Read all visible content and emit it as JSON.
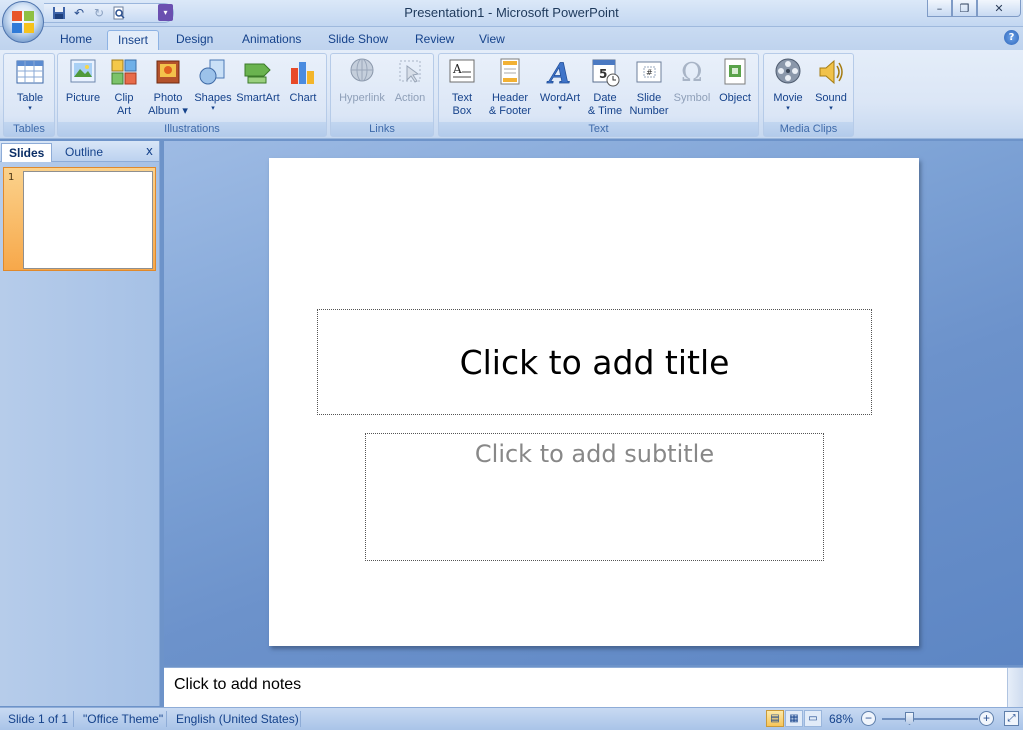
{
  "window": {
    "title": "Presentation1 - Microsoft PowerPoint",
    "controls": {
      "minimize": "–",
      "restore": "❐",
      "close": "✕"
    }
  },
  "qat": {
    "save_icon": "save-icon",
    "undo_icon": "undo-icon",
    "redo_icon": "redo-icon",
    "preview_icon": "print-preview-icon"
  },
  "tabs": [
    "Home",
    "Insert",
    "Design",
    "Animations",
    "Slide Show",
    "Review",
    "View"
  ],
  "active_tab": "Insert",
  "help": "?",
  "ribbon": {
    "groups": {
      "tables": "Tables",
      "illustrations": "Illustrations",
      "links": "Links",
      "text": "Text",
      "media": "Media Clips"
    },
    "buttons": {
      "table": [
        "Table",
        "▾"
      ],
      "picture": [
        "Picture",
        ""
      ],
      "clipart": [
        "Clip",
        "Art"
      ],
      "photoalbum": [
        "Photo",
        "Album ▾"
      ],
      "shapes": [
        "Shapes",
        "▾"
      ],
      "smartart": [
        "SmartArt",
        ""
      ],
      "chart": [
        "Chart",
        ""
      ],
      "hyperlink": [
        "Hyperlink",
        ""
      ],
      "action": [
        "Action",
        ""
      ],
      "textbox": [
        "Text",
        "Box"
      ],
      "headerfooter": [
        "Header",
        "& Footer"
      ],
      "wordart": [
        "WordArt",
        "▾"
      ],
      "datetime": [
        "Date",
        "& Time"
      ],
      "slidenumber": [
        "Slide",
        "Number"
      ],
      "symbol": [
        "Symbol",
        ""
      ],
      "object": [
        "Object",
        ""
      ],
      "movie": [
        "Movie",
        "▾"
      ],
      "sound": [
        "Sound",
        "▾"
      ]
    }
  },
  "pane": {
    "tab_slides": "Slides",
    "tab_outline": "Outline",
    "close": "x",
    "thumb_number": "1"
  },
  "slide": {
    "title_placeholder": "Click to add title",
    "subtitle_placeholder": "Click to add subtitle"
  },
  "notes": {
    "placeholder": "Click to add notes"
  },
  "status": {
    "slide": "Slide 1 of 1",
    "theme": "\"Office Theme\"",
    "language": "English (United States)",
    "zoom": "68%"
  }
}
